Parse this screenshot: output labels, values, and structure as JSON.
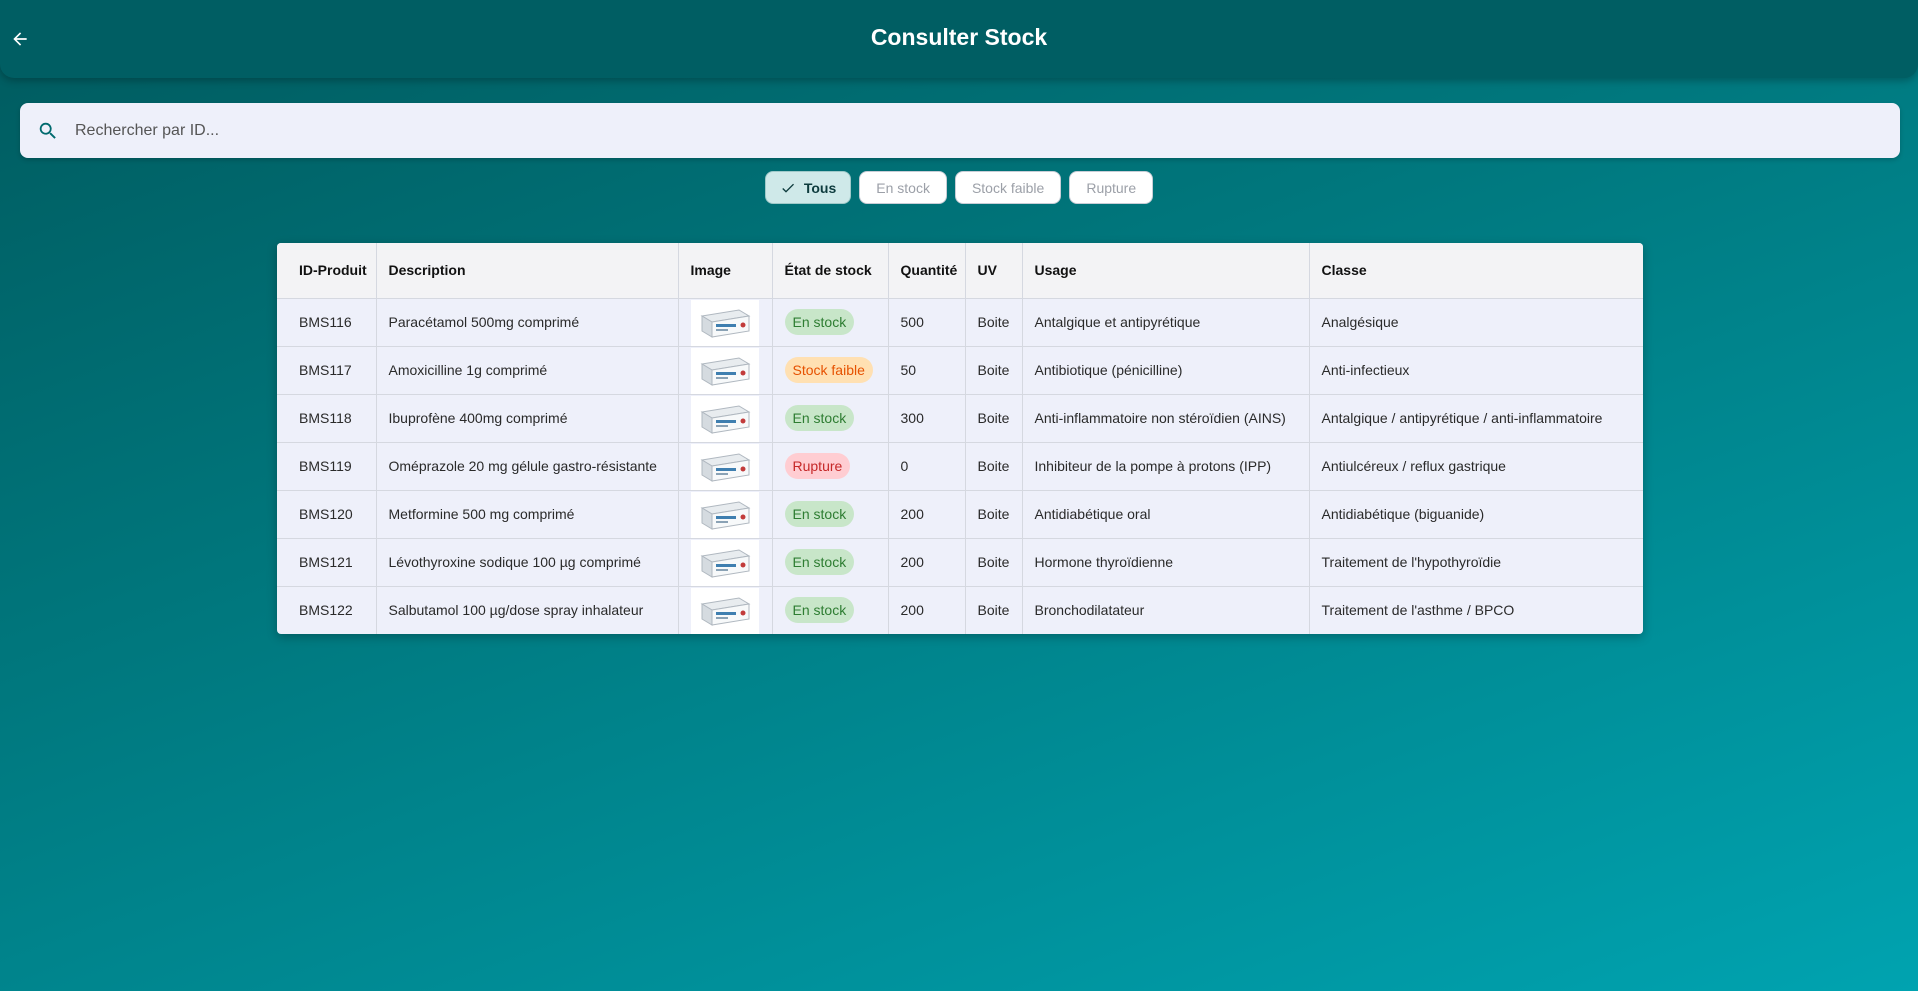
{
  "appbar": {
    "title": "Consulter Stock",
    "back_icon": "arrow-back-icon"
  },
  "search": {
    "placeholder": "Rechercher par ID...",
    "value": "",
    "icon": "search-icon"
  },
  "filters": [
    {
      "label": "Tous",
      "selected": true
    },
    {
      "label": "En stock",
      "selected": false
    },
    {
      "label": "Stock faible",
      "selected": false
    },
    {
      "label": "Rupture",
      "selected": false
    }
  ],
  "table": {
    "headers": [
      "ID-Produit",
      "Description",
      "Image",
      "État de stock",
      "Quantité",
      "UV",
      "Usage",
      "Classe"
    ],
    "rows": [
      {
        "id": "BMS116",
        "description": "Paracétamol 500mg comprimé",
        "status": "En stock",
        "quantity": "500",
        "uv": "Boite",
        "usage": "Antalgique et antipyrétique",
        "classe": "Analgésique"
      },
      {
        "id": "BMS117",
        "description": "Amoxicilline 1g comprimé",
        "status": "Stock faible",
        "quantity": "50",
        "uv": "Boite",
        "usage": " Antibiotique (pénicilline)",
        "classe": "Anti-infectieux"
      },
      {
        "id": "BMS118",
        "description": "Ibuprofène 400mg comprimé",
        "status": "En stock",
        "quantity": "300",
        "uv": "Boite",
        "usage": "Anti-inflammatoire non stéroïdien (AINS)",
        "classe": "Antalgique / antipyrétique / anti-inflammatoire"
      },
      {
        "id": "BMS119",
        "description": "Oméprazole 20 mg gélule gastro-résistante",
        "status": "Rupture",
        "quantity": "0",
        "uv": "Boite",
        "usage": " Inhibiteur de la pompe à protons (IPP)",
        "classe": "Antiulcéreux / reflux gastrique"
      },
      {
        "id": "BMS120",
        "description": "Metformine 500 mg comprimé",
        "status": "En stock",
        "quantity": "200",
        "uv": "Boite",
        "usage": "Antidiabétique oral",
        "classe": "Antidiabétique (biguanide)"
      },
      {
        "id": "BMS121",
        "description": "Lévothyroxine sodique 100 µg comprimé",
        "status": "En stock",
        "quantity": "200",
        "uv": "Boite",
        "usage": "Hormone thyroïdienne",
        "classe": "Traitement de l'hypothyroïdie"
      },
      {
        "id": "BMS122",
        "description": "Salbutamol 100 µg/dose spray inhalateur",
        "status": "En stock",
        "quantity": "200",
        "uv": "Boite",
        "usage": "Bronchodilatateur",
        "classe": "Traitement de l'asthme / BPCO"
      }
    ]
  },
  "status_colors": {
    "En stock": {
      "bg": "#c8e6c9",
      "fg": "#2e7d32"
    },
    "Stock faible": {
      "bg": "#ffe0b2",
      "fg": "#e65100"
    },
    "Rupture": {
      "bg": "#ffcdd2",
      "fg": "#c62828"
    }
  },
  "colors": {
    "appbar": "#005e63",
    "accent": "#00a3b0"
  }
}
